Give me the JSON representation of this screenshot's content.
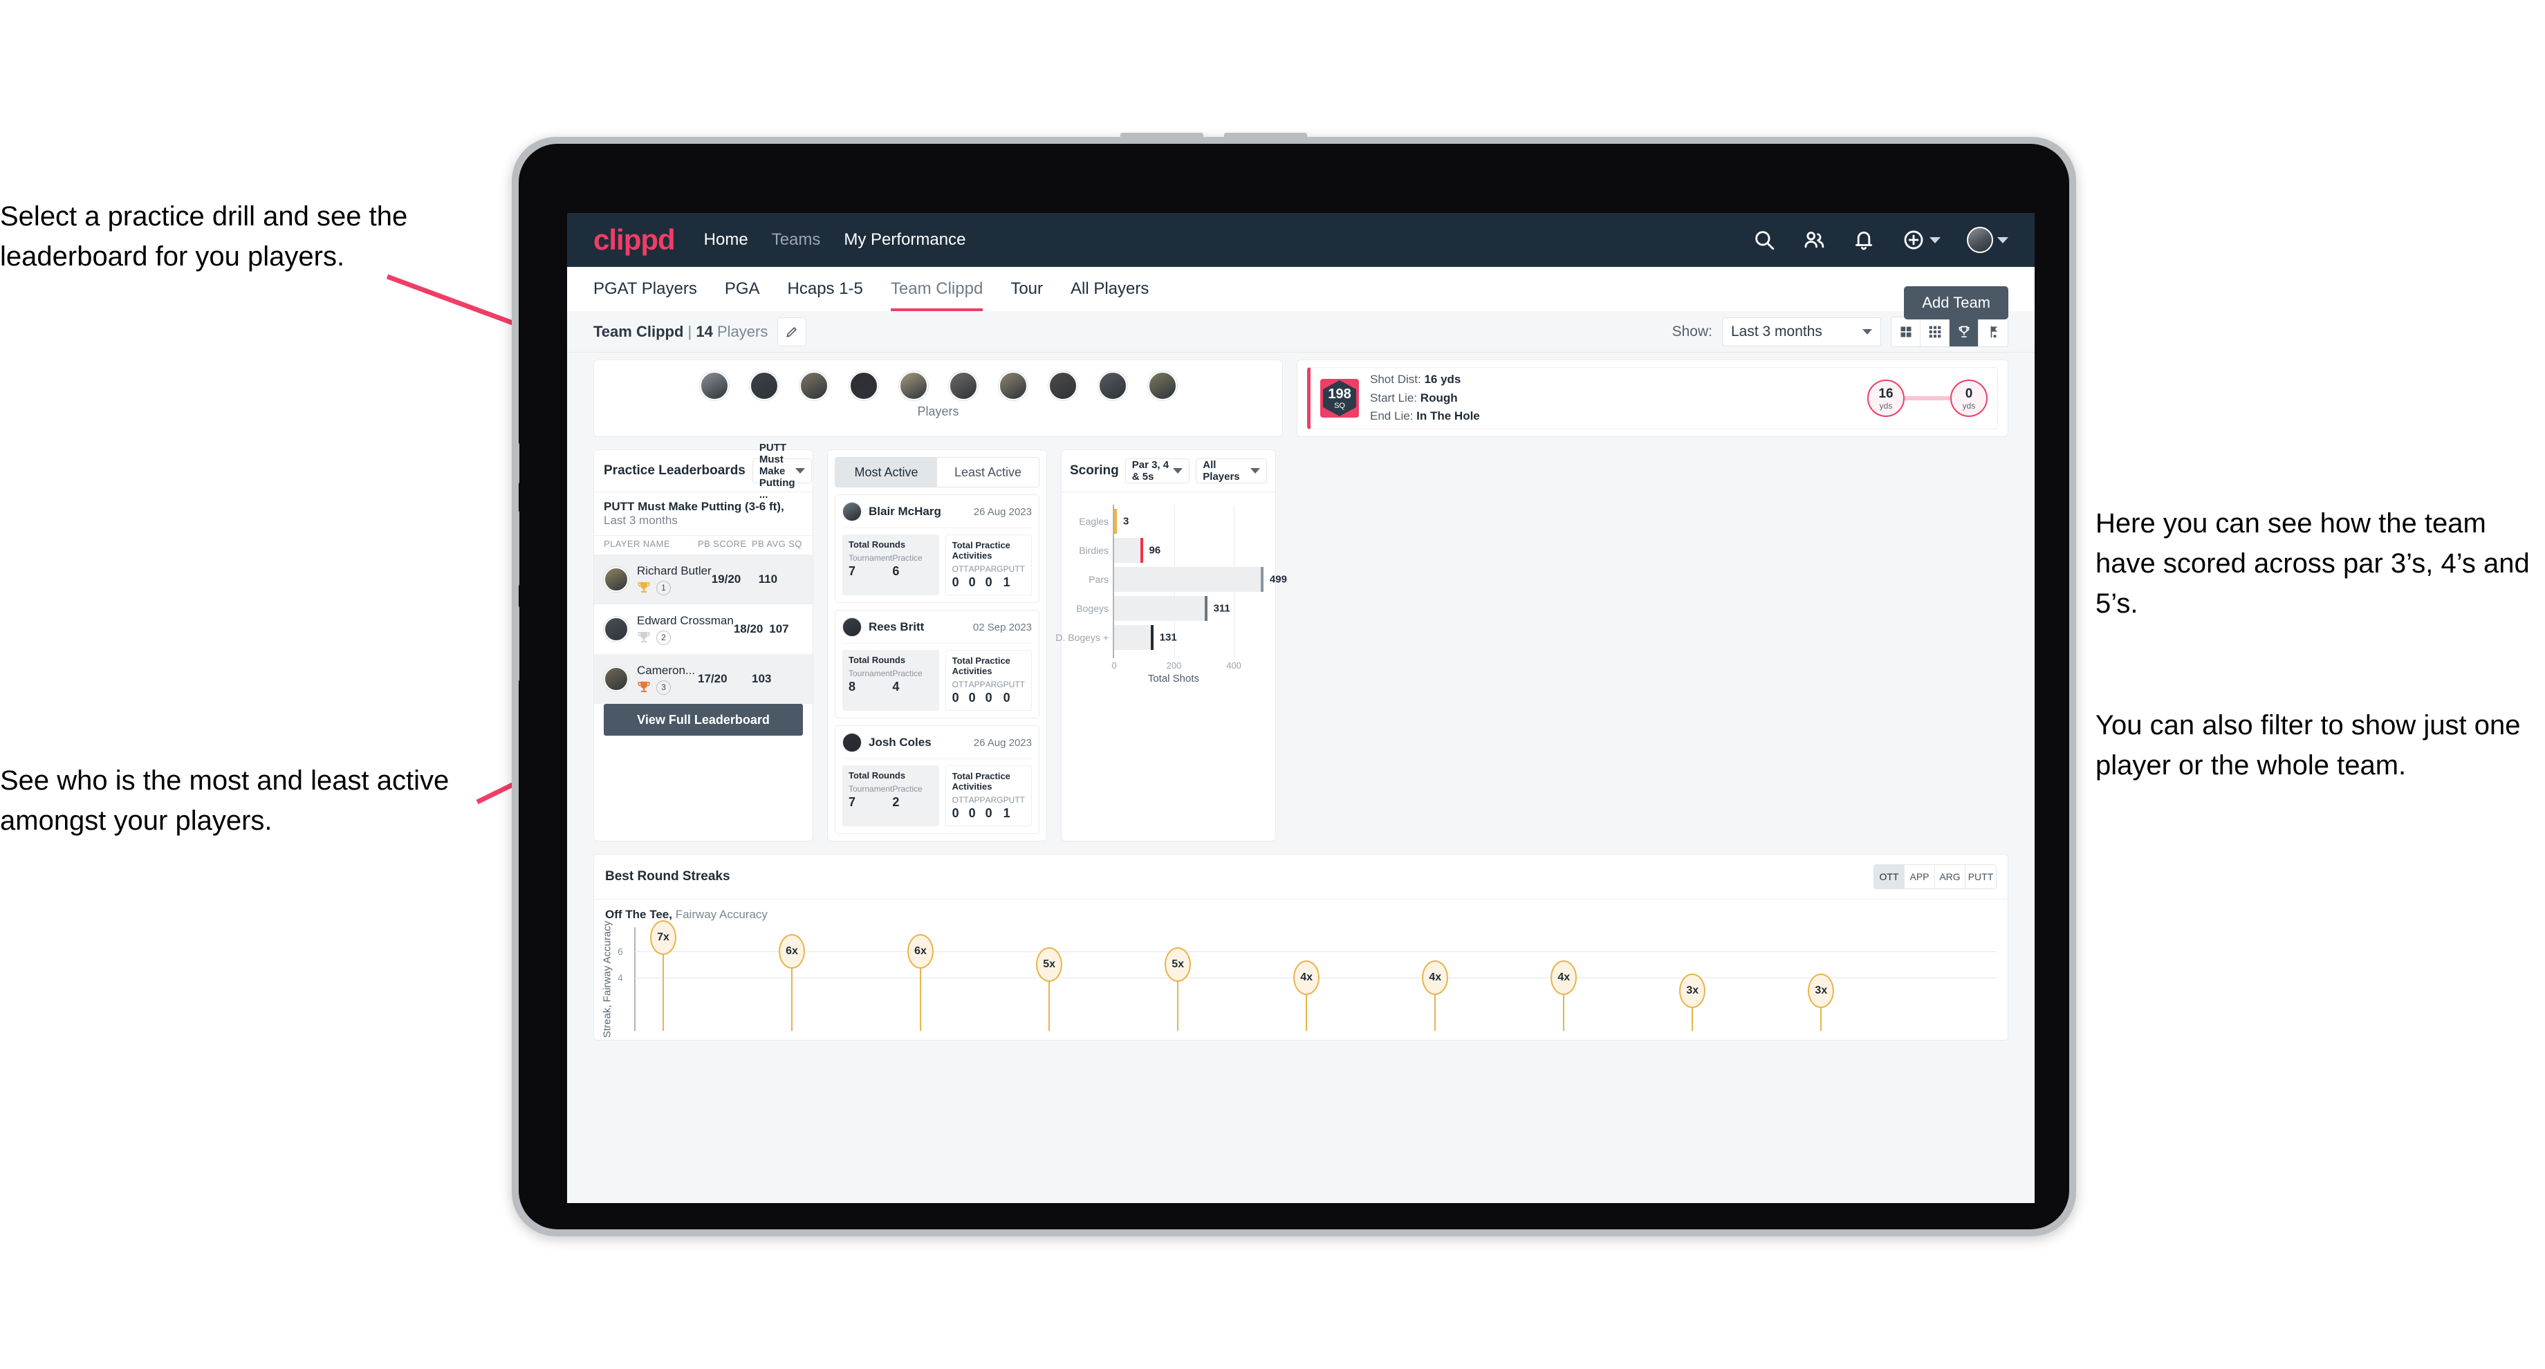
{
  "annotations": {
    "top_left": "Select a practice drill and see the leaderboard for you players.",
    "bottom_left": "See who is the most and least active amongst your players.",
    "right_1": "Here you can see how the team have scored across par 3’s, 4’s and 5’s.",
    "right_2": "You can also filter to show just one player or the whole team."
  },
  "topnav": {
    "logo": "clippd",
    "links": [
      {
        "label": "Home",
        "dim": false
      },
      {
        "label": "Teams",
        "dim": true
      },
      {
        "label": "My Performance",
        "dim": false
      }
    ],
    "icons": [
      "search-icon",
      "people-icon",
      "bell-icon",
      "plus-circle-icon",
      "avatar"
    ]
  },
  "tabbar": {
    "tabs": [
      {
        "label": "PGAT Players",
        "active": false
      },
      {
        "label": "PGA",
        "active": false
      },
      {
        "label": "Hcaps 1-5",
        "active": false
      },
      {
        "label": "Team Clippd",
        "active": true
      },
      {
        "label": "Tour",
        "active": false
      },
      {
        "label": "All Players",
        "active": false
      }
    ],
    "add_team": "Add Team"
  },
  "subheader": {
    "team_name": "Team Clippd",
    "separator": "|",
    "player_count": "14",
    "players_word": "Players",
    "edit_icon": "pencil-icon",
    "show_label": "Show:",
    "show_value": "Last 3 months",
    "view_toggles": [
      {
        "icon": "grid-large-icon",
        "active": false
      },
      {
        "icon": "grid-small-icon",
        "active": false
      },
      {
        "icon": "trophy-icon",
        "active": true
      },
      {
        "icon": "flag-icon",
        "active": false
      }
    ]
  },
  "players_strip": {
    "caption": "Players",
    "avatars": [
      "#8a9099",
      "#3b4148",
      "#7d7663",
      "#2e2e31",
      "#a39a7e",
      "#6c6a64",
      "#8c8470",
      "#4d4b46",
      "#545a62",
      "#7b7a5f"
    ]
  },
  "shot_card": {
    "sq_value": "198",
    "sq_unit": "SQ",
    "lines": [
      {
        "label": "Shot Dist:",
        "value": "16 yds"
      },
      {
        "label": "Start Lie:",
        "value": "Rough"
      },
      {
        "label": "End Lie:",
        "value": "In The Hole"
      }
    ],
    "start_yds": "16",
    "start_unit": "yds",
    "end_yds": "0",
    "end_unit": "yds"
  },
  "leaderboard": {
    "title": "Practice Leaderboards",
    "select_value": "PUTT Must Make Putting ...",
    "subtitle_bold": "PUTT Must Make Putting (3-6 ft),",
    "subtitle_light": " Last 3 months",
    "columns": [
      "PLAYER NAME",
      "PB SCORE",
      "PB AVG SQ"
    ],
    "rows": [
      {
        "name": "Richard Butler",
        "rank": "1",
        "trophy": "gold",
        "pb_score": "19/20",
        "pb_avg_sq": "110",
        "avatar": "#8d8562"
      },
      {
        "name": "Edward Crossman",
        "rank": "2",
        "trophy": "silver",
        "pb_score": "18/20",
        "pb_avg_sq": "107",
        "avatar": "#4a4e55"
      },
      {
        "name": "Cameron...",
        "rank": "3",
        "trophy": "bronze",
        "pb_score": "17/20",
        "pb_avg_sq": "103",
        "avatar": "#6e6a52"
      }
    ],
    "button": "View Full Leaderboard"
  },
  "activity": {
    "tabs": [
      {
        "label": "Most Active",
        "active": true
      },
      {
        "label": "Least Active",
        "active": false
      }
    ],
    "rounds_header": "Total Rounds",
    "practice_header": "Total Practice Activities",
    "rounds_labels": [
      "Tournament",
      "Practice"
    ],
    "practice_labels": [
      "OTT",
      "APP",
      "ARG",
      "PUTT"
    ],
    "items": [
      {
        "name": "Blair McHarg",
        "date": "26 Aug 2023",
        "avatar": "#6f7a86",
        "rounds": [
          "7",
          "6"
        ],
        "practice": [
          "0",
          "0",
          "0",
          "1"
        ]
      },
      {
        "name": "Rees Britt",
        "date": "02 Sep 2023",
        "avatar": "#3a4049",
        "rounds": [
          "8",
          "4"
        ],
        "practice": [
          "0",
          "0",
          "0",
          "0"
        ]
      },
      {
        "name": "Josh Coles",
        "date": "26 Aug 2023",
        "avatar": "#2d3036",
        "rounds": [
          "7",
          "2"
        ],
        "practice": [
          "0",
          "0",
          "0",
          "1"
        ]
      }
    ]
  },
  "scoring": {
    "title": "Scoring",
    "filter_par": "Par 3, 4 & 5s",
    "filter_players": "All Players"
  },
  "streaks": {
    "title": "Best Round Streaks",
    "toggles": [
      {
        "label": "OTT",
        "active": true
      },
      {
        "label": "APP",
        "active": false
      },
      {
        "label": "ARG",
        "active": false
      },
      {
        "label": "PUTT",
        "active": false
      }
    ],
    "sub_bold": "Off The Tee,",
    "sub_light": " Fairway Accuracy"
  },
  "chart_data": [
    {
      "type": "bar",
      "title": "Scoring",
      "orientation": "horizontal",
      "categories": [
        "Eagles",
        "Birdies",
        "Pars",
        "Bogeys",
        "D. Bogeys +"
      ],
      "values": [
        3,
        96,
        499,
        311,
        131
      ],
      "cap_colors": [
        "#e8b44a",
        "#ef3344",
        "#8d959c",
        "#6d757d",
        "#1f2b36"
      ],
      "xlabel": "Total Shots",
      "ylabel": "",
      "xlim": [
        0,
        520
      ],
      "xticks": [
        0,
        200,
        400
      ],
      "grid": true,
      "legend": "none"
    },
    {
      "type": "scatter",
      "title": "Best Round Streaks",
      "subtitle": "Off The Tee, Fairway Accuracy",
      "ylabel": "Streak, Fairway Accuracy",
      "xlabel": "",
      "ylim": [
        0,
        7.8
      ],
      "yticks": [
        4,
        6
      ],
      "grid": true,
      "labels": [
        "7x",
        "6x",
        "6x",
        "5x",
        "5x",
        "4x",
        "4x",
        "4x",
        "3x",
        "3x"
      ],
      "values": [
        7,
        6,
        6,
        5,
        5,
        4,
        4,
        4,
        3,
        3
      ],
      "marker": "ellipse-bubble-with-stem",
      "marker_color": "#fdf3e3",
      "marker_border": "#e8b44a"
    }
  ],
  "colors": {
    "brand_pink": "#ef3e66",
    "nav_dark": "#1e2d3b",
    "button_slate": "#4b5966",
    "page_bg": "#f5f6f8",
    "amber": "#e8b44a"
  }
}
